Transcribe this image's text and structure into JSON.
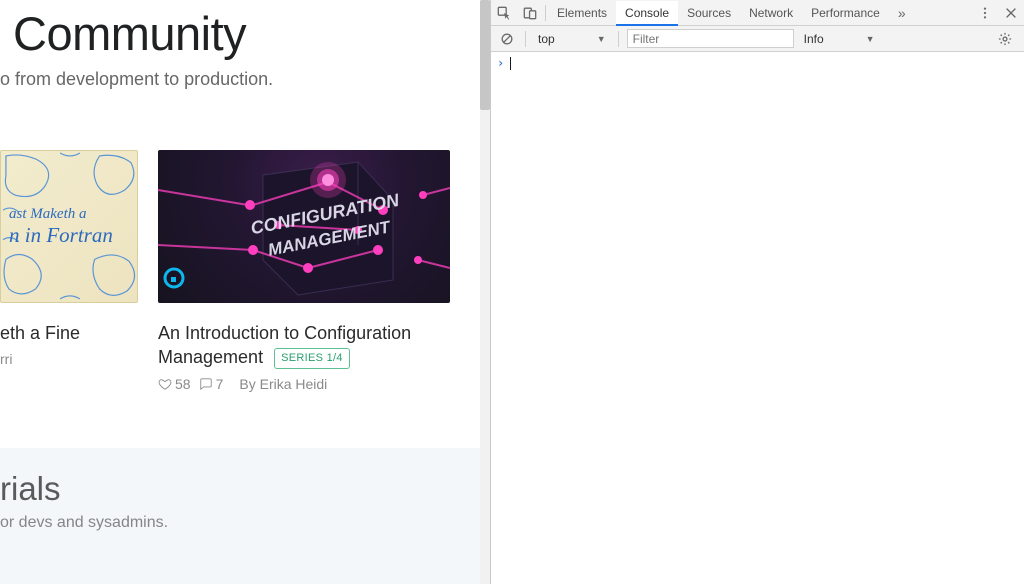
{
  "page": {
    "heroTitle": "Community",
    "heroSub": "o from development to production.",
    "cards": [
      {
        "title": "eth a Fine",
        "byline": "rri",
        "thumbLine1": "ast Maketh a",
        "thumbLine2": "n in Fortran"
      },
      {
        "title": "An Introduction to Configuration Management",
        "badge": "SERIES 1/4",
        "likes": "58",
        "comments": "7",
        "byline": "By Erika Heidi",
        "thumbLabel1": "CONFIGURATION",
        "thumbLabel2": "MANAGEMENT"
      }
    ],
    "tutsTitle": "rials",
    "tutsSub": "or devs and sysadmins."
  },
  "devtools": {
    "tabs": [
      "Elements",
      "Console",
      "Sources",
      "Network",
      "Performance"
    ],
    "activeTab": "Console",
    "moreGlyph": "»",
    "context": "top",
    "filterPlaceholder": "Filter",
    "level": "Info",
    "prompt": "›"
  }
}
